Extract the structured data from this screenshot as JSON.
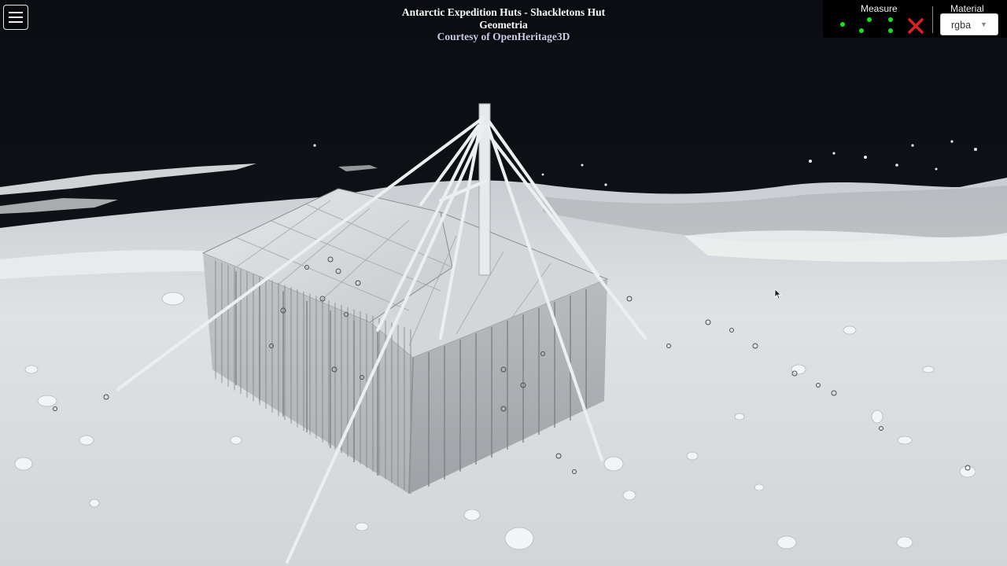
{
  "header": {
    "title": "Antarctic Expedition Huts - Shackletons Hut",
    "subtitle": "Geometria",
    "courtesy": "Courtesy of OpenHeritage3D"
  },
  "toolbar": {
    "menu_icon": "hamburger-menu-icon",
    "measure_label": "Measure",
    "measure_tool_icons": [
      "point-measure-icon",
      "distance-measure-icon",
      "area-measure-icon"
    ],
    "clear_icon": "close-icon",
    "material_label": "Material",
    "material_value": "rgba"
  },
  "colors": {
    "background": "#0b0f14",
    "point_cloud": "#e6e8eb",
    "measure_dot": "#19e019",
    "clear_red": "#e02020",
    "title_text": "#ffffff",
    "courtesy_text": "#c8cdea"
  }
}
